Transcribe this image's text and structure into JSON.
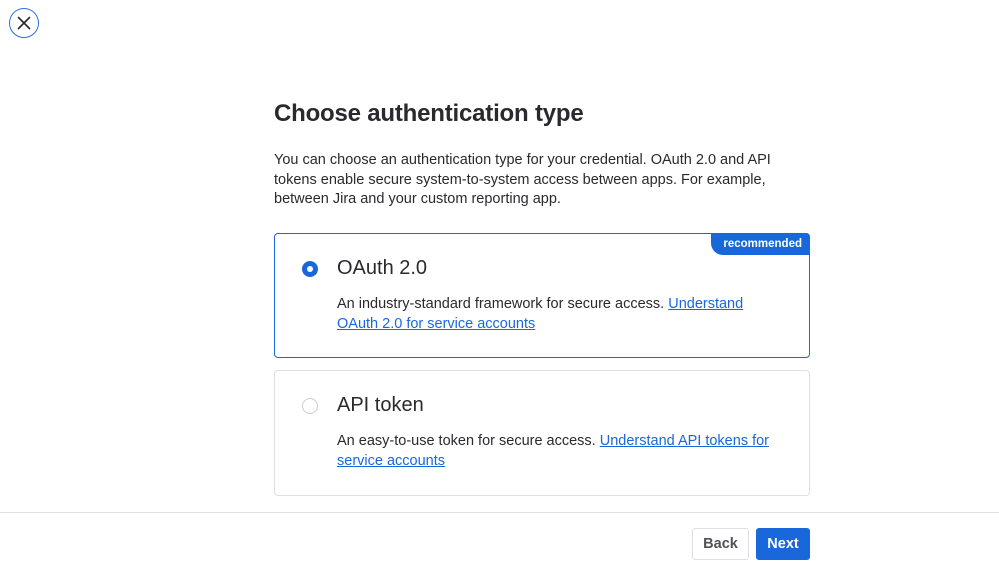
{
  "dialog": {
    "title": "Choose authentication type",
    "intro": "You can choose an authentication type for your credential. OAuth 2.0 and API tokens enable secure system-to-system access between apps. For example, between Jira and your custom reporting app."
  },
  "options": [
    {
      "label": "OAuth 2.0",
      "selected": true,
      "badge": "recommended",
      "description": "An industry-standard framework for secure access.",
      "link_text": "Understand OAuth 2.0 for service accounts"
    },
    {
      "label": "API token",
      "selected": false,
      "description": "An easy-to-use token for secure access.",
      "link_text": "Understand API tokens for service accounts"
    }
  ],
  "footer": {
    "back_label": "Back",
    "next_label": "Next"
  },
  "icons": {
    "close": "close-icon"
  },
  "colors": {
    "accent": "#1868db",
    "text": "#292a2e",
    "border": "#dcdfe4"
  }
}
